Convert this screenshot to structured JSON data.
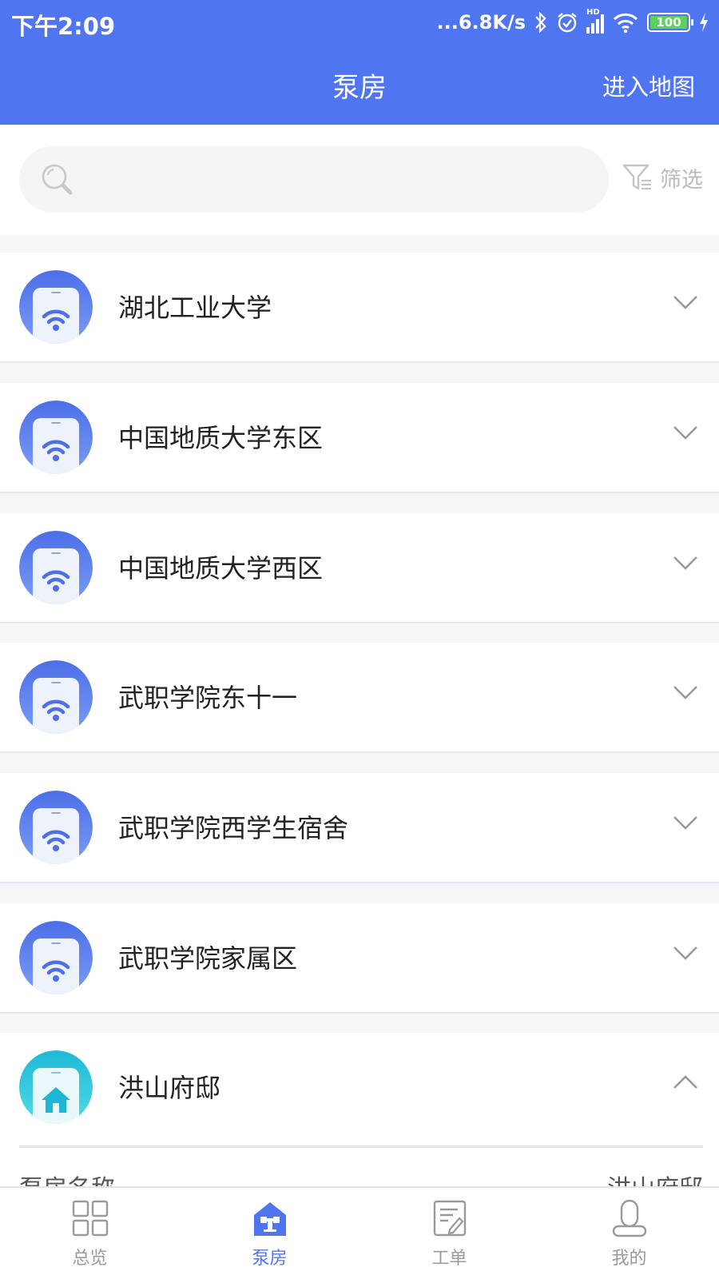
{
  "status_bar": {
    "time": "下午2:09",
    "network_speed": "...6.8K/s",
    "hd_badge": "HD",
    "battery": "100"
  },
  "header": {
    "title": "泵房",
    "map_link": "进入地图"
  },
  "search": {
    "placeholder": "",
    "filter_label": "筛选"
  },
  "pump_rooms": [
    {
      "name": "湖北工业大学",
      "icon": "wifi-icon",
      "expanded": false
    },
    {
      "name": "中国地质大学东区",
      "icon": "wifi-icon",
      "expanded": false
    },
    {
      "name": "中国地质大学西区",
      "icon": "wifi-icon",
      "expanded": false
    },
    {
      "name": "武职学院东十一",
      "icon": "wifi-icon",
      "expanded": false
    },
    {
      "name": "武职学院西学生宿舍",
      "icon": "wifi-icon",
      "expanded": false
    },
    {
      "name": "武职学院家属区",
      "icon": "wifi-icon",
      "expanded": false
    }
  ],
  "expanded_room": {
    "name": "洪山府邸",
    "icon": "home-icon",
    "expanded": true,
    "detail_left_partial": "泵房名称",
    "detail_right_partial": "洪山府邸"
  },
  "tabs": [
    {
      "label": "总览",
      "icon": "grid-icon",
      "active": false
    },
    {
      "label": "泵房",
      "icon": "pump-house-icon",
      "active": true
    },
    {
      "label": "工单",
      "icon": "work-order-icon",
      "active": false
    },
    {
      "label": "我的",
      "icon": "user-icon",
      "active": false
    }
  ],
  "colors": {
    "primary": "#4f76f0",
    "icon_blue": "#5b7ff0",
    "icon_cyan": "#24c3db",
    "inactive": "#9a9a9a",
    "background": "#f5f6f8"
  }
}
